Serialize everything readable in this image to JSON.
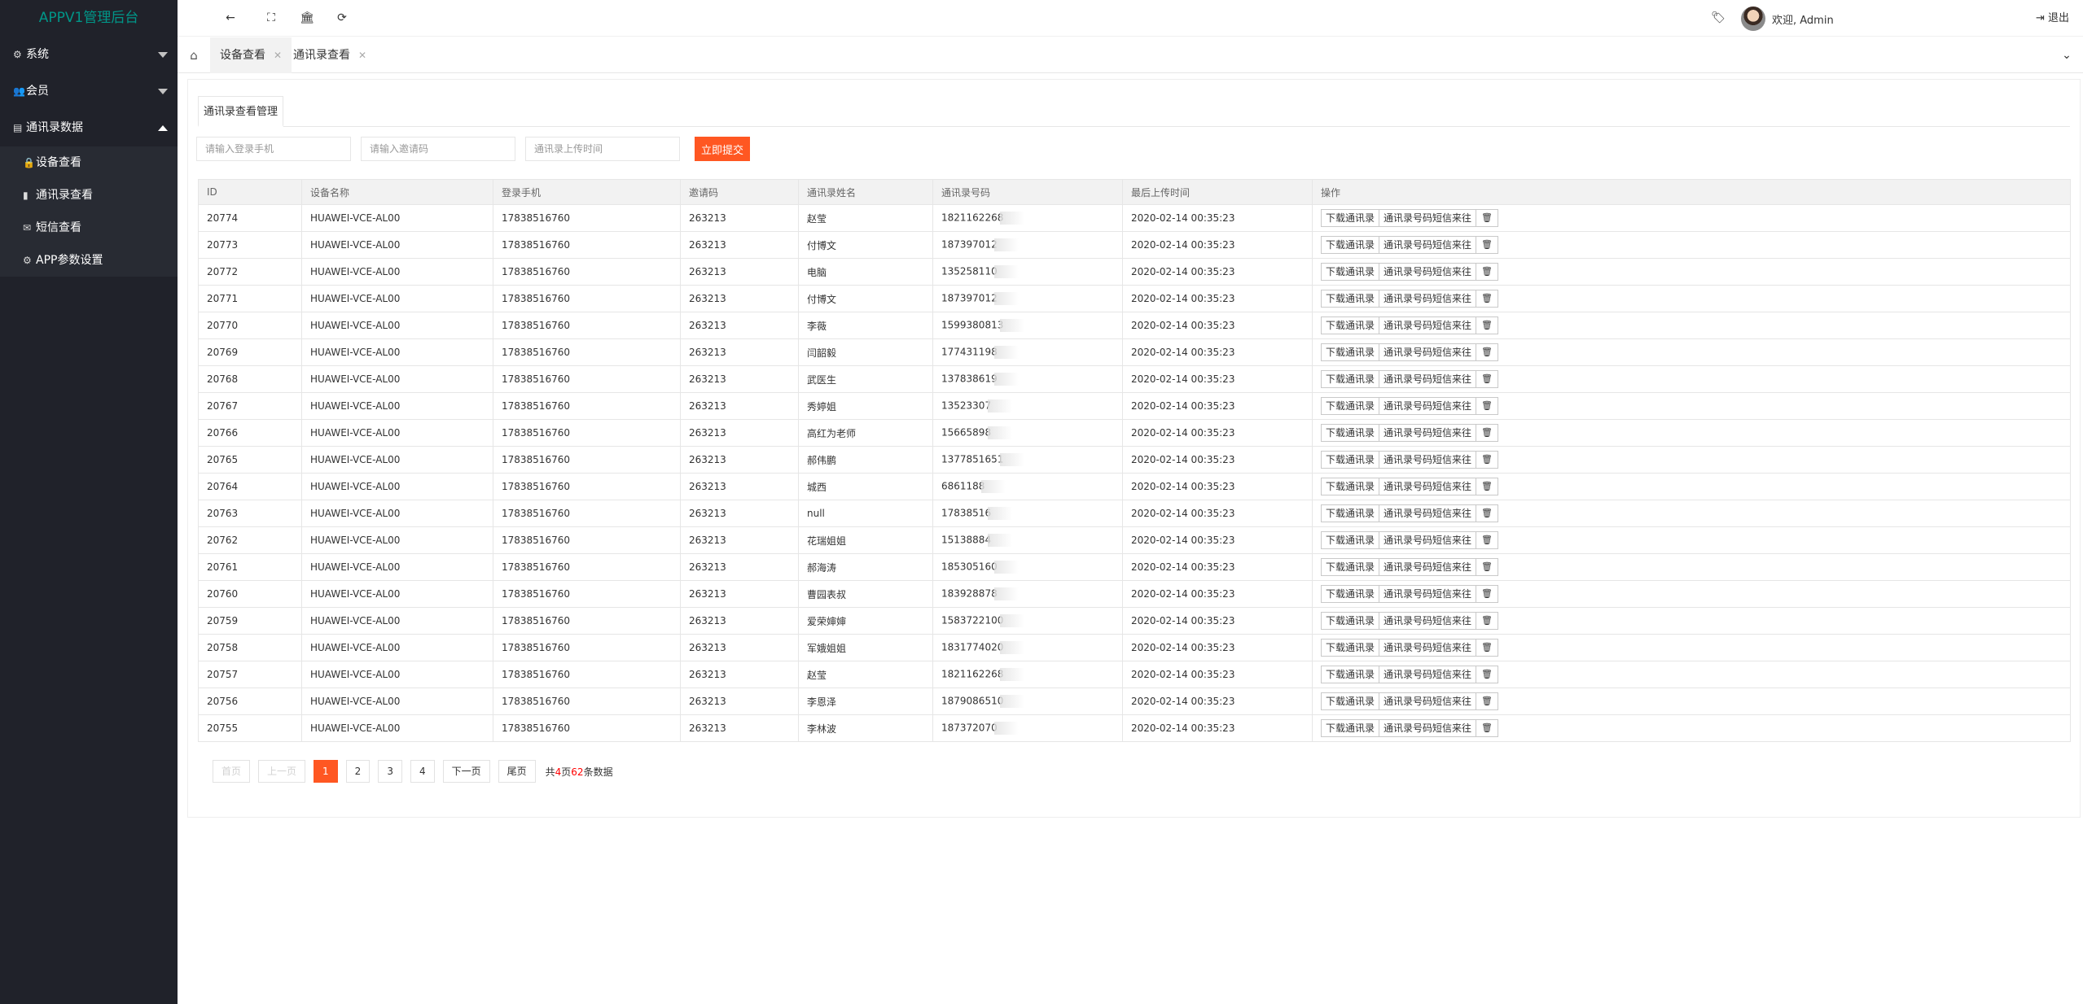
{
  "app": {
    "title": "APPV1管理后台"
  },
  "sidebar": {
    "items": [
      {
        "label": "系统",
        "icon": "gear-icon"
      },
      {
        "label": "会员",
        "icon": "users-icon"
      },
      {
        "label": "通讯录数据",
        "icon": "id-card-icon"
      }
    ],
    "subitems": [
      {
        "label": "设备查看",
        "icon": "lock-icon"
      },
      {
        "label": "通讯录查看",
        "icon": "book-icon"
      },
      {
        "label": "短信查看",
        "icon": "envelope-icon"
      },
      {
        "label": "APP参数设置",
        "icon": "gear-icon"
      }
    ]
  },
  "header": {
    "welcome": "欢迎, Admin",
    "logout": "退出"
  },
  "tabs": [
    {
      "label": "设备查看"
    },
    {
      "label": "通讯录查看"
    }
  ],
  "card": {
    "tab_label": "通讯录查看管理"
  },
  "filters": {
    "phone_placeholder": "请输入登录手机",
    "invite_placeholder": "请输入邀请码",
    "time_placeholder": "通讯录上传时间",
    "submit_label": "立即提交"
  },
  "table": {
    "headers": [
      "ID",
      "设备名称",
      "登录手机",
      "邀请码",
      "通讯录姓名",
      "通讯录号码",
      "最后上传时间",
      "操作"
    ],
    "actions": {
      "download": "下载通讯录",
      "contact": "通讯录号码短信来往"
    },
    "rows": [
      {
        "id": "20774",
        "device": "HUAWEI-VCE-AL00",
        "phone": "17838516760",
        "invite": "263213",
        "name": "赵莹",
        "number": "1821162268",
        "time": "2020-02-14 00:35:23"
      },
      {
        "id": "20773",
        "device": "HUAWEI-VCE-AL00",
        "phone": "17838516760",
        "invite": "263213",
        "name": "付博文",
        "number": "187397012",
        "time": "2020-02-14 00:35:23"
      },
      {
        "id": "20772",
        "device": "HUAWEI-VCE-AL00",
        "phone": "17838516760",
        "invite": "263213",
        "name": "电脑",
        "number": "135258110",
        "time": "2020-02-14 00:35:23"
      },
      {
        "id": "20771",
        "device": "HUAWEI-VCE-AL00",
        "phone": "17838516760",
        "invite": "263213",
        "name": "付博文",
        "number": "187397012",
        "time": "2020-02-14 00:35:23"
      },
      {
        "id": "20770",
        "device": "HUAWEI-VCE-AL00",
        "phone": "17838516760",
        "invite": "263213",
        "name": "李薇",
        "number": "1599380813",
        "time": "2020-02-14 00:35:23"
      },
      {
        "id": "20769",
        "device": "HUAWEI-VCE-AL00",
        "phone": "17838516760",
        "invite": "263213",
        "name": "闫韶毅",
        "number": "177431198",
        "time": "2020-02-14 00:35:23"
      },
      {
        "id": "20768",
        "device": "HUAWEI-VCE-AL00",
        "phone": "17838516760",
        "invite": "263213",
        "name": "武医生",
        "number": "137838619",
        "time": "2020-02-14 00:35:23"
      },
      {
        "id": "20767",
        "device": "HUAWEI-VCE-AL00",
        "phone": "17838516760",
        "invite": "263213",
        "name": "秀婷姐",
        "number": "13523307",
        "time": "2020-02-14 00:35:23"
      },
      {
        "id": "20766",
        "device": "HUAWEI-VCE-AL00",
        "phone": "17838516760",
        "invite": "263213",
        "name": "高红为老师",
        "number": "15665898",
        "time": "2020-02-14 00:35:23"
      },
      {
        "id": "20765",
        "device": "HUAWEI-VCE-AL00",
        "phone": "17838516760",
        "invite": "263213",
        "name": "郝伟鹏",
        "number": "1377851651",
        "time": "2020-02-14 00:35:23"
      },
      {
        "id": "20764",
        "device": "HUAWEI-VCE-AL00",
        "phone": "17838516760",
        "invite": "263213",
        "name": "城西",
        "number": "6861188",
        "time": "2020-02-14 00:35:23"
      },
      {
        "id": "20763",
        "device": "HUAWEI-VCE-AL00",
        "phone": "17838516760",
        "invite": "263213",
        "name": "null",
        "number": "17838516",
        "time": "2020-02-14 00:35:23"
      },
      {
        "id": "20762",
        "device": "HUAWEI-VCE-AL00",
        "phone": "17838516760",
        "invite": "263213",
        "name": "花瑞姐姐",
        "number": "15138884",
        "time": "2020-02-14 00:35:23"
      },
      {
        "id": "20761",
        "device": "HUAWEI-VCE-AL00",
        "phone": "17838516760",
        "invite": "263213",
        "name": "郝海涛",
        "number": "185305160",
        "time": "2020-02-14 00:35:23"
      },
      {
        "id": "20760",
        "device": "HUAWEI-VCE-AL00",
        "phone": "17838516760",
        "invite": "263213",
        "name": "曹园表叔",
        "number": "183928878",
        "time": "2020-02-14 00:35:23"
      },
      {
        "id": "20759",
        "device": "HUAWEI-VCE-AL00",
        "phone": "17838516760",
        "invite": "263213",
        "name": "爱荣婶婶",
        "number": "1583722100",
        "time": "2020-02-14 00:35:23"
      },
      {
        "id": "20758",
        "device": "HUAWEI-VCE-AL00",
        "phone": "17838516760",
        "invite": "263213",
        "name": "军娥姐姐",
        "number": "1831774020",
        "time": "2020-02-14 00:35:23"
      },
      {
        "id": "20757",
        "device": "HUAWEI-VCE-AL00",
        "phone": "17838516760",
        "invite": "263213",
        "name": "赵莹",
        "number": "1821162268",
        "time": "2020-02-14 00:35:23"
      },
      {
        "id": "20756",
        "device": "HUAWEI-VCE-AL00",
        "phone": "17838516760",
        "invite": "263213",
        "name": "李恩泽",
        "number": "1879086510",
        "time": "2020-02-14 00:35:23"
      },
      {
        "id": "20755",
        "device": "HUAWEI-VCE-AL00",
        "phone": "17838516760",
        "invite": "263213",
        "name": "李林波",
        "number": "187372070",
        "time": "2020-02-14 00:35:23"
      }
    ]
  },
  "pagination": {
    "first": "首页",
    "prev": "上一页",
    "pages": [
      "1",
      "2",
      "3",
      "4"
    ],
    "current": "1",
    "next": "下一页",
    "last": "尾页",
    "info_prefix": "共",
    "total_pages": "4",
    "info_mid": "页",
    "total_items": "62",
    "info_suffix": "条数据"
  },
  "colors": {
    "accent": "#ff5722",
    "sidebar": "#20222a",
    "logo": "#009688"
  }
}
